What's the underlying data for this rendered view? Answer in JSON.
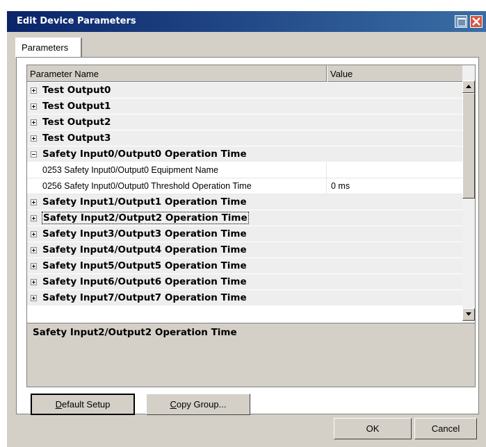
{
  "window": {
    "title": "Edit Device Parameters"
  },
  "tabs": [
    {
      "label": "Parameters"
    }
  ],
  "grid": {
    "columns": {
      "name": "Parameter Name",
      "value": "Value"
    },
    "rows": [
      {
        "type": "group",
        "expanded": false,
        "name": "Test Output0"
      },
      {
        "type": "group",
        "expanded": false,
        "name": "Test Output1"
      },
      {
        "type": "group",
        "expanded": false,
        "name": "Test Output2"
      },
      {
        "type": "group",
        "expanded": false,
        "name": "Test Output3"
      },
      {
        "type": "group",
        "expanded": true,
        "name": "Safety Input0/Output0 Operation Time"
      },
      {
        "type": "param",
        "name": "0253 Safety Input0/Output0 Equipment Name",
        "value": ""
      },
      {
        "type": "param",
        "name": "0256 Safety Input0/Output0 Threshold Operation Time",
        "value": "0 ms"
      },
      {
        "type": "group",
        "expanded": false,
        "name": "Safety Input1/Output1 Operation Time"
      },
      {
        "type": "group",
        "expanded": false,
        "name": "Safety Input2/Output2 Operation Time",
        "selected": true
      },
      {
        "type": "group",
        "expanded": false,
        "name": "Safety Input3/Output3 Operation Time"
      },
      {
        "type": "group",
        "expanded": false,
        "name": "Safety Input4/Output4 Operation Time"
      },
      {
        "type": "group",
        "expanded": false,
        "name": "Safety Input5/Output5 Operation Time"
      },
      {
        "type": "group",
        "expanded": false,
        "name": "Safety Input6/Output6 Operation Time"
      },
      {
        "type": "group",
        "expanded": false,
        "name": "Safety Input7/Output7 Operation Time"
      }
    ]
  },
  "description": {
    "text": "Safety Input2/Output2 Operation Time"
  },
  "buttons": {
    "default_setup": {
      "hotkey": "D",
      "rest": "efault Setup"
    },
    "copy_group": {
      "hotkey": "C",
      "rest": "opy Group..."
    },
    "ok": "OK",
    "cancel": "Cancel"
  },
  "colors": {
    "title_start": "#0a246a",
    "title_end": "#3a6ea5",
    "close": "#d5563f",
    "face": "#d4d0c8"
  }
}
